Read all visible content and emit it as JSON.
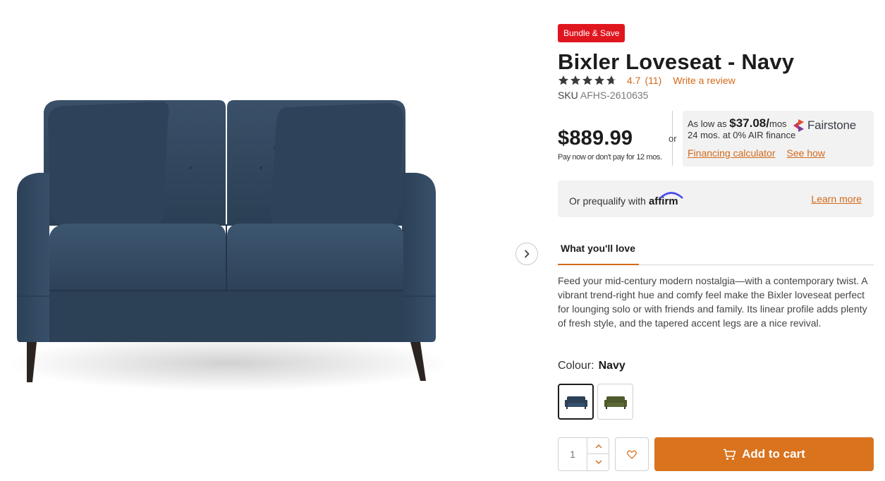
{
  "product": {
    "badge": "Bundle & Save",
    "title": "Bixler Loveseat - Navy",
    "rating": "4.7",
    "rating_stars": 4.7,
    "review_count": "(11)",
    "write_review": "Write a review",
    "sku_label": "SKU",
    "sku": "AFHS-2610635",
    "image_alt": "Bixler Loveseat - Navy"
  },
  "price": {
    "amount": "$889.99",
    "note": "Pay now or don't pay for 12 mos.",
    "or": "or"
  },
  "financing": {
    "as_low_as": "As low as",
    "monthly": "$37.08/",
    "mos": "mos",
    "terms": "24 mos. at 0% AIR finance",
    "brand": "Fairstone",
    "calculator_link": "Financing calculator",
    "see_how_link": "See how"
  },
  "affirm": {
    "text": "Or prequalify with",
    "brand": "affirm",
    "learn_more": "Learn more"
  },
  "tabs": {
    "active": "What you'll love"
  },
  "description": "Feed your mid-century modern nostalgia—with a contemporary twist. A vibrant trend-right hue and comfy feel make the Bixler loveseat perfect for lounging solo or with friends and family. Its linear profile adds plenty of fresh style, and the tapered accent legs are a nice revival.",
  "colour": {
    "label": "Colour:",
    "selected": "Navy",
    "swatches": [
      {
        "name": "Navy",
        "color": "#2c4057",
        "selected": true
      },
      {
        "name": "Green",
        "color": "#4e5a2c",
        "selected": false
      }
    ]
  },
  "cart": {
    "quantity": "1",
    "add_to_cart": "Add to cart"
  },
  "colors": {
    "accent": "#d26a1b",
    "cart_button": "#d9731e",
    "badge": "#e0161f",
    "sofa_fabric": "#2f4458"
  },
  "icons": {
    "next": "chevron-right-icon",
    "star": "star-icon",
    "wishlist": "heart-icon",
    "cart": "cart-icon",
    "qty_up": "chevron-up-icon",
    "qty_down": "chevron-down-icon",
    "fairstone": "fairstone-logo-icon"
  }
}
